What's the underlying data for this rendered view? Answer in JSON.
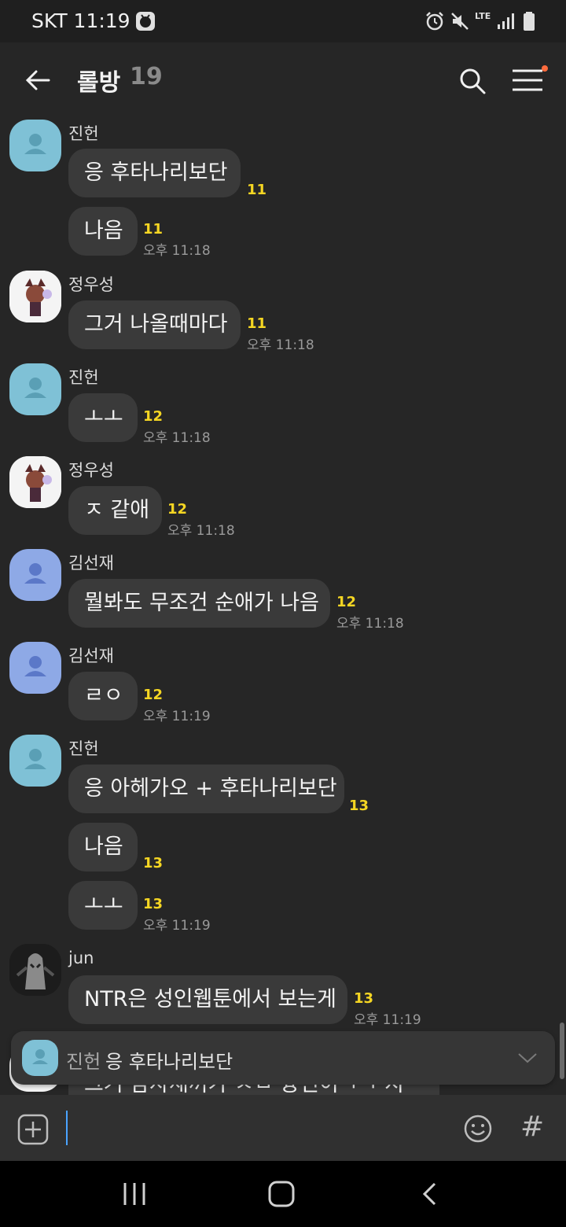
{
  "status_bar": {
    "carrier_time": "SKT 11:19",
    "network": "LTE"
  },
  "header": {
    "title": "롤방",
    "member_count": "19"
  },
  "messages": [
    {
      "sender": "진헌",
      "text": "응 후타나리보단",
      "unread": "11",
      "time": ""
    },
    {
      "sender": "",
      "text": "나음",
      "unread": "11",
      "time": "오후 11:18"
    },
    {
      "sender": "정우성",
      "text": "그거 나올때마다",
      "unread": "11",
      "time": "오후 11:18"
    },
    {
      "sender": "진헌",
      "text": "ㅗㅗ",
      "unread": "12",
      "time": "오후 11:18"
    },
    {
      "sender": "정우성",
      "text": "ㅈ 같애",
      "unread": "12",
      "time": "오후 11:18"
    },
    {
      "sender": "김선재",
      "text": "뭘봐도 무조건 순애가 나음",
      "unread": "12",
      "time": "오후 11:18"
    },
    {
      "sender": "김선재",
      "text": "ㄹㅇ",
      "unread": "12",
      "time": "오후 11:19"
    },
    {
      "sender": "진헌",
      "text": "응 아헤가오 + 후타나리보단",
      "unread": "13",
      "time": ""
    },
    {
      "sender": "",
      "text": "나음",
      "unread": "13",
      "time": ""
    },
    {
      "sender": "",
      "text": "ㅗㅗ",
      "unread": "13",
      "time": "오후 11:19"
    },
    {
      "sender": "jun",
      "text": "NTR은 성인웹툰에서 보는게",
      "unread": "13",
      "time": "오후 11:19"
    }
  ],
  "hidden_peek_text": "그거 남자새끼가 ㅅㅂ 븅신이ㅋㅋ 지",
  "notice": {
    "sender": "진헌",
    "message": "응 후타나리보단"
  },
  "input": {
    "value": "",
    "hash_symbol": "#"
  },
  "icons": {
    "back": "arrow-left-icon",
    "search": "search-icon",
    "menu": "hamburger-menu-icon",
    "attach": "plus-box-icon",
    "emoji": "smiley-icon",
    "nav_recents": "recents-icon",
    "nav_home": "home-icon",
    "nav_back": "back-chevron-icon"
  },
  "colors": {
    "background": "#262626",
    "bubble": "#3a3a3a",
    "unread": "#f5d623",
    "avatar_default_1": "#7fc1d6",
    "avatar_default_2": "#8ea9e6"
  }
}
